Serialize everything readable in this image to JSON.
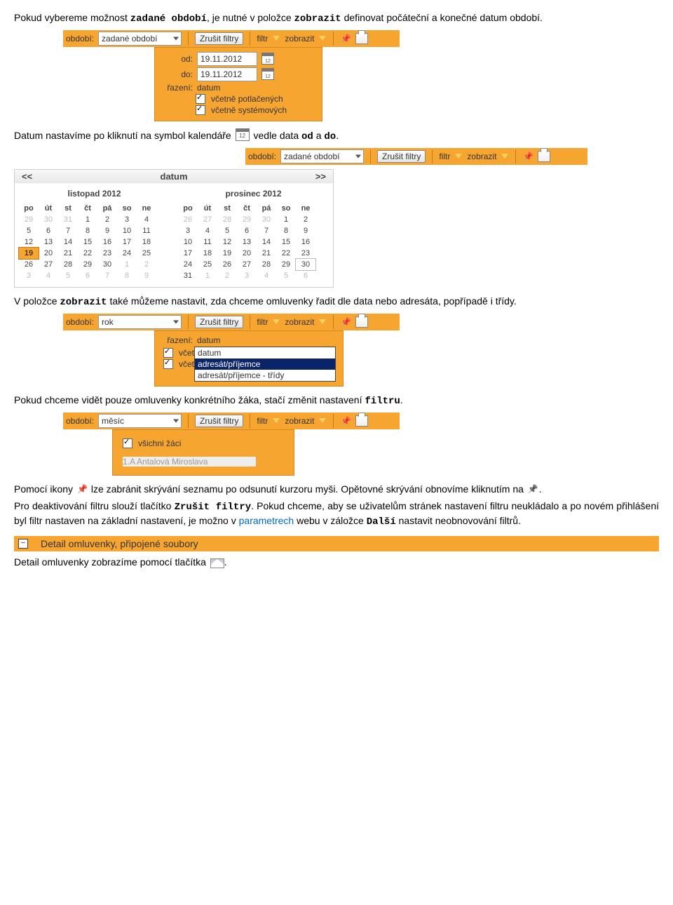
{
  "para1": {
    "t1": "Pokud vybereme možnost ",
    "b1": "zadané období",
    "t2": ", je nutné v položce ",
    "b2": "zobrazit",
    "t3": " definovat počáteční a konečné datum období."
  },
  "toolbar1": {
    "lbl_obdobi": "období:",
    "val_obdobi": "zadané období",
    "btn_zrusit": "Zrušit filtry",
    "lbl_filtr": "filtr",
    "lbl_zobrazit": "zobrazit"
  },
  "panel1": {
    "od_lbl": "od:",
    "od_val": "19.11.2012",
    "do_lbl": "do:",
    "do_val": "19.11.2012",
    "razeni_lbl": "řazení:",
    "razeni_val": "datum",
    "chk1": "včetně potlačených",
    "chk2": "včetně systémových"
  },
  "para2": {
    "t1": "Datum nastavíme po kliknutí na symbol kalendáře ",
    "t2": " vedle data ",
    "b1": "od",
    "t3": " a ",
    "b2": "do",
    "t4": "."
  },
  "calendar": {
    "prev": "<<",
    "next": ">>",
    "title": "datum",
    "m1": {
      "name": "listopad 2012",
      "dow": [
        "po",
        "út",
        "st",
        "čt",
        "pá",
        "so",
        "ne"
      ],
      "rows": [
        [
          {
            "d": "29",
            "dim": true
          },
          {
            "d": "30",
            "dim": true
          },
          {
            "d": "31",
            "dim": true
          },
          {
            "d": "1"
          },
          {
            "d": "2"
          },
          {
            "d": "3"
          },
          {
            "d": "4"
          }
        ],
        [
          {
            "d": "5"
          },
          {
            "d": "6"
          },
          {
            "d": "7"
          },
          {
            "d": "8"
          },
          {
            "d": "9"
          },
          {
            "d": "10"
          },
          {
            "d": "11"
          }
        ],
        [
          {
            "d": "12"
          },
          {
            "d": "13"
          },
          {
            "d": "14"
          },
          {
            "d": "15"
          },
          {
            "d": "16"
          },
          {
            "d": "17"
          },
          {
            "d": "18"
          }
        ],
        [
          {
            "d": "19",
            "sel": true
          },
          {
            "d": "20"
          },
          {
            "d": "21"
          },
          {
            "d": "22"
          },
          {
            "d": "23"
          },
          {
            "d": "24"
          },
          {
            "d": "25"
          }
        ],
        [
          {
            "d": "26"
          },
          {
            "d": "27"
          },
          {
            "d": "28"
          },
          {
            "d": "29"
          },
          {
            "d": "30"
          },
          {
            "d": "1",
            "dim": true
          },
          {
            "d": "2",
            "dim": true
          }
        ],
        [
          {
            "d": "3",
            "dim": true
          },
          {
            "d": "4",
            "dim": true
          },
          {
            "d": "5",
            "dim": true
          },
          {
            "d": "6",
            "dim": true
          },
          {
            "d": "7",
            "dim": true
          },
          {
            "d": "8",
            "dim": true
          },
          {
            "d": "9",
            "dim": true
          }
        ]
      ]
    },
    "m2": {
      "name": "prosinec 2012",
      "dow": [
        "po",
        "út",
        "st",
        "čt",
        "pá",
        "so",
        "ne"
      ],
      "rows": [
        [
          {
            "d": "26",
            "dim": true
          },
          {
            "d": "27",
            "dim": true
          },
          {
            "d": "28",
            "dim": true
          },
          {
            "d": "29",
            "dim": true
          },
          {
            "d": "30",
            "dim": true
          },
          {
            "d": "1"
          },
          {
            "d": "2"
          }
        ],
        [
          {
            "d": "3"
          },
          {
            "d": "4"
          },
          {
            "d": "5"
          },
          {
            "d": "6"
          },
          {
            "d": "7"
          },
          {
            "d": "8"
          },
          {
            "d": "9"
          }
        ],
        [
          {
            "d": "10"
          },
          {
            "d": "11"
          },
          {
            "d": "12"
          },
          {
            "d": "13"
          },
          {
            "d": "14"
          },
          {
            "d": "15"
          },
          {
            "d": "16"
          }
        ],
        [
          {
            "d": "17"
          },
          {
            "d": "18"
          },
          {
            "d": "19"
          },
          {
            "d": "20"
          },
          {
            "d": "21"
          },
          {
            "d": "22"
          },
          {
            "d": "23"
          }
        ],
        [
          {
            "d": "24"
          },
          {
            "d": "25"
          },
          {
            "d": "26"
          },
          {
            "d": "27"
          },
          {
            "d": "28"
          },
          {
            "d": "29"
          },
          {
            "d": "30",
            "box": true
          }
        ],
        [
          {
            "d": "31"
          },
          {
            "d": "1",
            "dim": true
          },
          {
            "d": "2",
            "dim": true
          },
          {
            "d": "3",
            "dim": true
          },
          {
            "d": "4",
            "dim": true
          },
          {
            "d": "5",
            "dim": true
          },
          {
            "d": "6",
            "dim": true
          }
        ]
      ]
    }
  },
  "para3": {
    "t1": "V položce ",
    "b1": "zobrazit",
    "t2": " také můžeme nastavit, zda chceme omluvenky řadit dle data nebo adresáta, popřípadě i třídy."
  },
  "toolbar3": {
    "lbl_obdobi": "období:",
    "val_obdobi": "rok",
    "btn_zrusit": "Zrušit filtry",
    "lbl_filtr": "filtr",
    "lbl_zobrazit": "zobrazit"
  },
  "panel3": {
    "razeni_lbl": "řazení:",
    "razeni_val": "datum",
    "opts": [
      {
        "label": "datum"
      },
      {
        "label": "adresát/příjemce",
        "sel": true
      },
      {
        "label": "adresát/příjemce - třídy"
      }
    ],
    "chk_prefix": "včet"
  },
  "para4": "Pokud chceme vidět pouze omluvenky konkrétního žáka, stačí změnit nastavení ",
  "para4_b": "filtru",
  "toolbar4": {
    "lbl_obdobi": "období:",
    "val_obdobi": "měsíc",
    "btn_zrusit": "Zrušit filtry",
    "lbl_filtr": "filtr",
    "lbl_zobrazit": "zobrazit"
  },
  "panel4": {
    "chk": "všichni žáci",
    "sel_val": "1.A Antalová Miroslava"
  },
  "para5": {
    "t1": "Pomocí ikony ",
    "t2": " lze zabránit skrývání seznamu po odsunutí kurzoru myši. Opětovné skrývání obnovíme kliknutím na ",
    "t3": "."
  },
  "para6": {
    "t1": "Pro deaktivování filtru slouží tlačítko ",
    "b1": "Zrušit filtry",
    "t2": ". Pokud chceme, aby se uživatelům stránek nastavení filtru neukládalo a po novém přihlášení byl filtr nastaven na základní nastavení, je možno v ",
    "link": "parametrech",
    "t3": " webu v záložce ",
    "b2": "Další",
    "t4": " nastavit neobnovování filtrů."
  },
  "section_head": "Detail omluvenky, připojené soubory",
  "para_last": "Detail omluvenky zobrazíme pomocí tlačítka "
}
